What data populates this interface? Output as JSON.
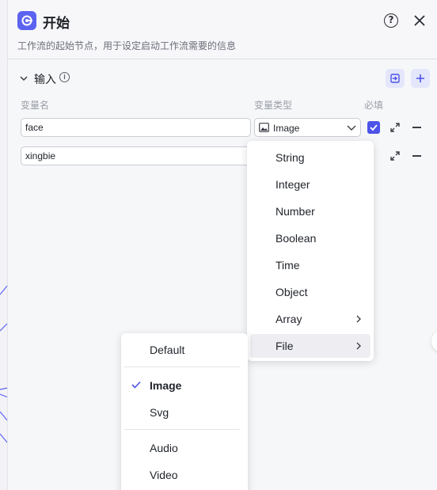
{
  "header": {
    "title": "开始",
    "description": "工作流的起始节点，用于设定启动工作流需要的信息",
    "help_icon": "help-circle-icon",
    "close_icon": "close-icon",
    "node_icon": "start-node-icon",
    "accent": "#4d53e8"
  },
  "inputs": {
    "section_title": "输入",
    "col_name": "变量名",
    "col_type": "变量类型",
    "col_required": "必填",
    "rows": [
      {
        "name": "face",
        "type": "Image",
        "required": true
      },
      {
        "name": "xingbie"
      }
    ]
  },
  "type_menu": {
    "items": [
      "String",
      "Integer",
      "Number",
      "Boolean",
      "Time",
      "Object",
      "Array",
      "File"
    ],
    "highlighted": "File"
  },
  "file_submenu": {
    "items": [
      "Default",
      "Image",
      "Svg",
      "Audio",
      "Video"
    ],
    "selected": "Image"
  }
}
